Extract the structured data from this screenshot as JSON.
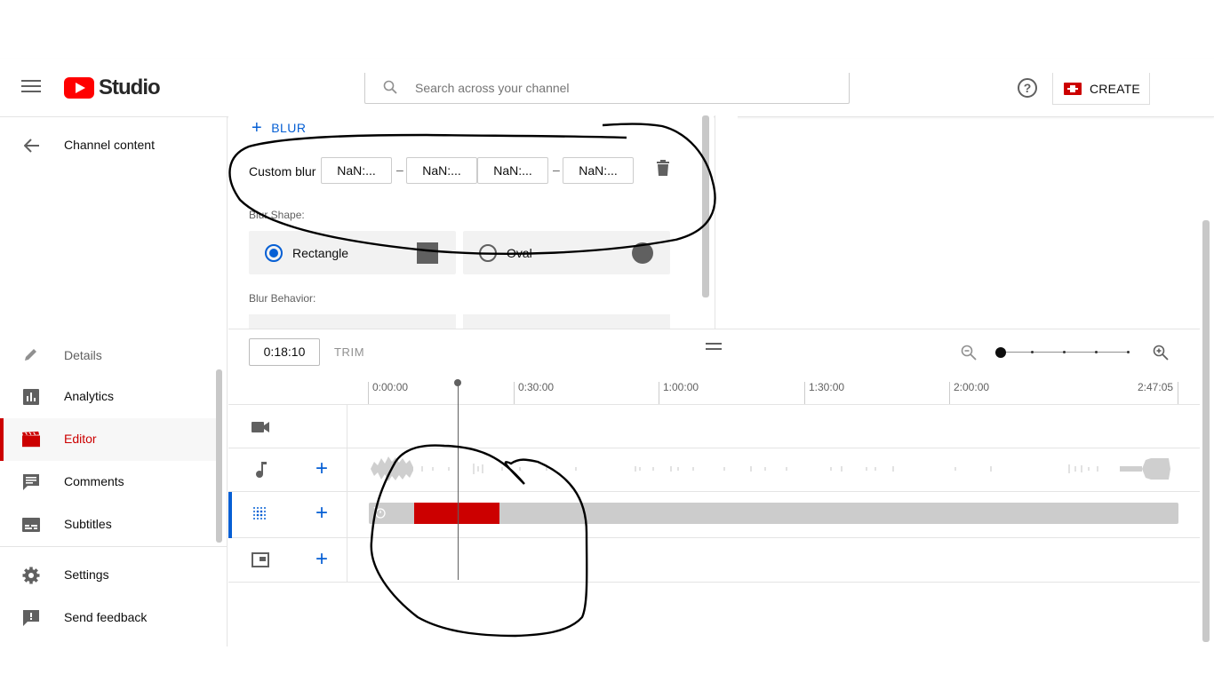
{
  "header": {
    "logo_text": "Studio",
    "search_placeholder": "Search across your channel",
    "create_label": "CREATE"
  },
  "sidebar": {
    "back_label": "Channel content",
    "items": [
      {
        "label": "Details",
        "icon": "pencil-icon"
      },
      {
        "label": "Analytics",
        "icon": "analytics-icon"
      },
      {
        "label": "Editor",
        "icon": "editor-icon",
        "active": true
      },
      {
        "label": "Comments",
        "icon": "comments-icon"
      },
      {
        "label": "Subtitles",
        "icon": "subtitles-icon"
      }
    ],
    "footer_items": [
      {
        "label": "Settings",
        "icon": "gear-icon"
      },
      {
        "label": "Send feedback",
        "icon": "feedback-icon"
      }
    ]
  },
  "blur_panel": {
    "add_label": "BLUR",
    "custom_blur_label": "Custom blur",
    "time_fields": [
      "NaN:...",
      "NaN:...",
      "NaN:...",
      "NaN:..."
    ],
    "dash": "–",
    "shape_label": "Blur Shape:",
    "shapes": [
      {
        "label": "Rectangle",
        "selected": true
      },
      {
        "label": "Oval",
        "selected": false
      }
    ],
    "behavior_label": "Blur Behavior:"
  },
  "timeline": {
    "timecode": "0:18:10",
    "trim_label": "TRIM",
    "ruler": [
      "0:00:00",
      "0:30:00",
      "1:00:00",
      "1:30:00",
      "2:00:00",
      "2:47:05"
    ],
    "tracks": [
      {
        "icon": "video-camera-icon",
        "addable": false
      },
      {
        "icon": "music-note-icon",
        "addable": true
      },
      {
        "icon": "blur-grid-icon",
        "addable": true,
        "active": true
      },
      {
        "icon": "end-screen-icon",
        "addable": true
      }
    ],
    "add_symbol": "+"
  },
  "colors": {
    "accent_red": "#cc0000",
    "link_blue": "#065fd4",
    "logo_red": "#ff0000"
  }
}
